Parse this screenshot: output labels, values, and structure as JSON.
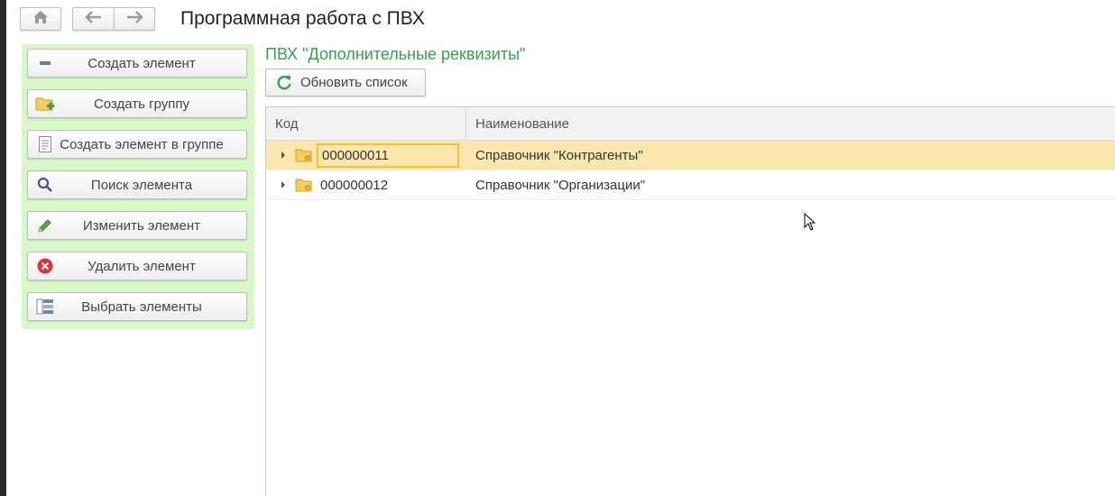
{
  "window": {
    "title": "Программная работа с ПВХ"
  },
  "commands": [
    {
      "label": "Создать элемент",
      "icon": "dash-icon"
    },
    {
      "label": "Создать группу",
      "icon": "folder-add-icon"
    },
    {
      "label": "Создать элемент в группе",
      "icon": "document-icon"
    },
    {
      "label": "Поиск элемента",
      "icon": "search-icon"
    },
    {
      "label": "Изменить элемент",
      "icon": "pencil-icon"
    },
    {
      "label": "Удалить элемент",
      "icon": "delete-icon"
    },
    {
      "label": "Выбрать элементы",
      "icon": "list-select-icon"
    }
  ],
  "form": {
    "title": "ПВХ \"Дополнительные реквизиты\"",
    "refresh_label": "Обновить список"
  },
  "table": {
    "columns": [
      "Код",
      "Наименование"
    ],
    "rows": [
      {
        "code": "000000011",
        "name": "Справочник \"Контрагенты\"",
        "selected": true
      },
      {
        "code": "000000012",
        "name": "Справочник \"Организации\"",
        "selected": false
      }
    ]
  },
  "colors": {
    "command_panel": "#d8f8c8",
    "form_title": "#3aa04c",
    "selected_row": "#fbe7ae",
    "selected_border": "#f2c23a"
  }
}
